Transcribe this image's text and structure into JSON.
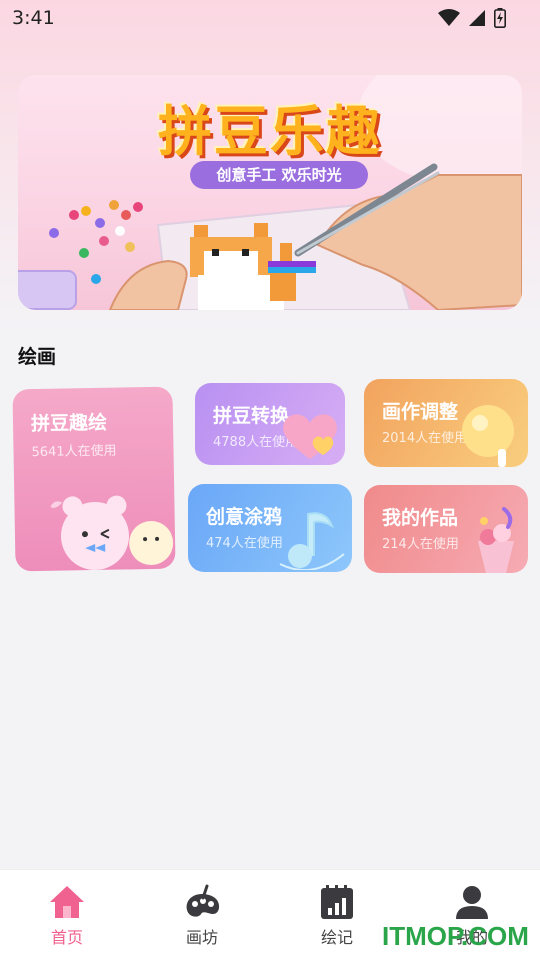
{
  "status_bar": {
    "time": "3:41"
  },
  "banner": {
    "title": "拼豆乐趣",
    "subtitle": "创意手工 欢乐时光"
  },
  "section": {
    "title": "绘画"
  },
  "cards": [
    {
      "title": "拼豆趣绘",
      "usage": "5641人在使用"
    },
    {
      "title": "拼豆转换",
      "usage": "4788人在使用"
    },
    {
      "title": "画作调整",
      "usage": "2014人在使用"
    },
    {
      "title": "创意涂鸦",
      "usage": "474人在使用"
    },
    {
      "title": "我的作品",
      "usage": "214人在使用"
    }
  ],
  "nav": {
    "active_color": "#f0628f",
    "items": [
      {
        "label": "首页",
        "icon": "home-icon"
      },
      {
        "label": "画坊",
        "icon": "palette-icon"
      },
      {
        "label": "绘记",
        "icon": "notebook-chart-icon"
      },
      {
        "label": "我的",
        "icon": "person-icon"
      }
    ]
  },
  "watermark": "ITMOP.COM"
}
